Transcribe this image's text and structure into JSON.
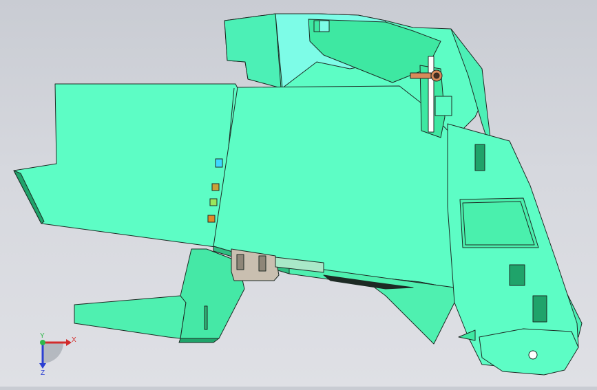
{
  "viewport": {
    "background_top": "#c9ccd3",
    "background_bottom": "#dfe0e5",
    "model": {
      "body_color": "#5dfdc5",
      "shade_color": "#3ee8a2",
      "dark_color": "#1fa36a",
      "edge_color": "#1d2a24",
      "pin_colors": [
        "#3fd7ff",
        "#c8a23a",
        "#9be65c",
        "#e08a2a"
      ],
      "bolt_color": "#d98a5a",
      "bracket_color": "#c9bfb0"
    }
  },
  "triad": {
    "x_label": "X",
    "y_label": "Y",
    "z_label": "Z",
    "x_color": "#d22b2b",
    "y_color": "#2fb84a",
    "z_color": "#2b3fd2"
  }
}
